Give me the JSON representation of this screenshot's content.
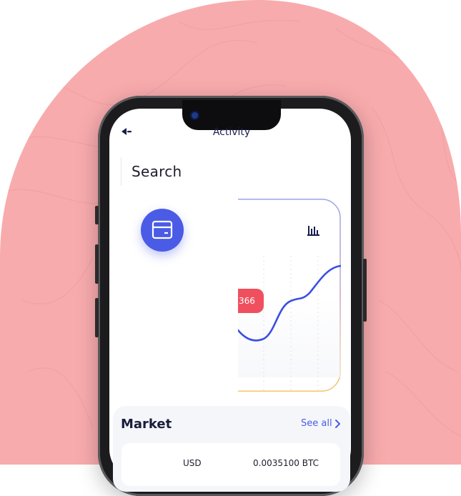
{
  "colors": {
    "blob": "#f8abad",
    "accent": "#4a5be6",
    "price_tag": "#f0505e",
    "curve": "#3c4fe0",
    "card_border_top": "#9aa3e6",
    "card_border_bottom": "#f4c66a"
  },
  "header": {
    "back_icon": "back-arrow-icon",
    "title": "Activity"
  },
  "search": {
    "label": "Search"
  },
  "wallet": {
    "icon": "wallet-icon"
  },
  "chart": {
    "icon": "bar-chart-icon",
    "price_label": "366"
  },
  "market": {
    "title": "Market",
    "see_all": "See all",
    "row": {
      "left": "USD",
      "right": "0.0035100 BTC"
    }
  }
}
